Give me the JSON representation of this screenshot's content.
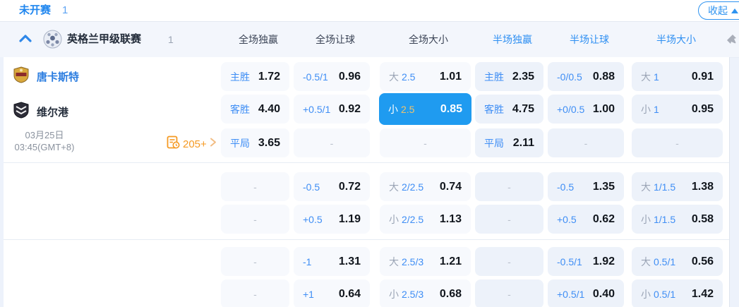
{
  "topbar": {
    "status": "未开赛",
    "count": "1",
    "collapse": "收起"
  },
  "league": {
    "name": "英格兰甲级联赛",
    "count": "1",
    "columns": [
      {
        "label": "全场独赢",
        "half": false
      },
      {
        "label": "全场让球",
        "half": false
      },
      {
        "label": "全场大小",
        "half": false
      },
      {
        "label": "半场独赢",
        "half": true
      },
      {
        "label": "半场让球",
        "half": true
      },
      {
        "label": "半场大小",
        "half": true
      }
    ]
  },
  "match": {
    "home": "唐卡斯特",
    "away": "维尔港",
    "date": "03月25日",
    "time": "03:45(GMT+8)",
    "markets": "205+"
  },
  "odds": {
    "groups": [
      {
        "rows": [
          [
            {
              "t": "lv",
              "label": "主胜",
              "value": "1.72"
            },
            {
              "t": "lv",
              "label": "-0.5/1",
              "value": "0.96"
            },
            {
              "t": "ou",
              "prefix": "大",
              "line": "2.5",
              "value": "1.01"
            },
            {
              "t": "lv",
              "label": "主胜",
              "value": "2.35"
            },
            {
              "t": "lv",
              "label": "-0/0.5",
              "value": "0.88"
            },
            {
              "t": "ou",
              "prefix": "大",
              "line": "1",
              "value": "0.91"
            }
          ],
          [
            {
              "t": "lv",
              "label": "客胜",
              "value": "4.40"
            },
            {
              "t": "lv",
              "label": "+0.5/1",
              "value": "0.92"
            },
            {
              "t": "ou",
              "prefix": "小",
              "line": "2.5",
              "value": "0.85",
              "selected": true
            },
            {
              "t": "lv",
              "label": "客胜",
              "value": "4.75"
            },
            {
              "t": "lv",
              "label": "+0/0.5",
              "value": "1.00"
            },
            {
              "t": "ou",
              "prefix": "小",
              "line": "1",
              "value": "0.95"
            }
          ],
          [
            {
              "t": "lv",
              "label": "平局",
              "value": "3.65"
            },
            {
              "t": "dash"
            },
            {
              "t": "dash"
            },
            {
              "t": "lv",
              "label": "平局",
              "value": "2.11"
            },
            {
              "t": "dash"
            },
            {
              "t": "dash"
            }
          ]
        ]
      },
      {
        "rows": [
          [
            {
              "t": "dash"
            },
            {
              "t": "lv",
              "label": "-0.5",
              "value": "0.72"
            },
            {
              "t": "ou",
              "prefix": "大",
              "line": "2/2.5",
              "value": "0.74"
            },
            {
              "t": "dash"
            },
            {
              "t": "lv",
              "label": "-0.5",
              "value": "1.35"
            },
            {
              "t": "ou",
              "prefix": "大",
              "line": "1/1.5",
              "value": "1.38"
            }
          ],
          [
            {
              "t": "dash"
            },
            {
              "t": "lv",
              "label": "+0.5",
              "value": "1.19"
            },
            {
              "t": "ou",
              "prefix": "小",
              "line": "2/2.5",
              "value": "1.13"
            },
            {
              "t": "dash"
            },
            {
              "t": "lv",
              "label": "+0.5",
              "value": "0.62"
            },
            {
              "t": "ou",
              "prefix": "小",
              "line": "1/1.5",
              "value": "0.58"
            }
          ]
        ]
      },
      {
        "rows": [
          [
            {
              "t": "dash"
            },
            {
              "t": "lv",
              "label": "-1",
              "value": "1.31"
            },
            {
              "t": "ou",
              "prefix": "大",
              "line": "2.5/3",
              "value": "1.21"
            },
            {
              "t": "dash"
            },
            {
              "t": "lv",
              "label": "-0.5/1",
              "value": "1.92"
            },
            {
              "t": "ou",
              "prefix": "大",
              "line": "0.5/1",
              "value": "0.56"
            }
          ],
          [
            {
              "t": "dash"
            },
            {
              "t": "lv",
              "label": "+1",
              "value": "0.64"
            },
            {
              "t": "ou",
              "prefix": "小",
              "line": "2.5/3",
              "value": "0.68"
            },
            {
              "t": "dash"
            },
            {
              "t": "lv",
              "label": "+0.5/1",
              "value": "0.40"
            },
            {
              "t": "ou",
              "prefix": "小",
              "line": "0.5/1",
              "value": "1.42"
            }
          ]
        ]
      }
    ]
  },
  "colors": {
    "accent_blue": "#2e8ff2",
    "selected_bg": "#1f9bf0",
    "selected_line_gold": "#eec36d",
    "markets_orange": "#f59a23"
  }
}
